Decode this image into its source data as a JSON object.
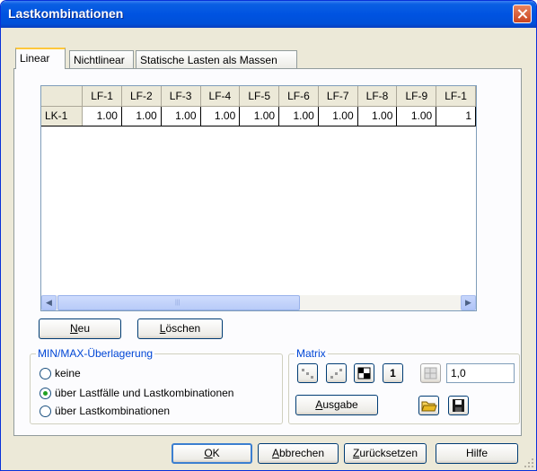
{
  "window": {
    "title": "Lastkombinationen"
  },
  "tabs": [
    {
      "label": "Linear",
      "active": true
    },
    {
      "label": "Nichtlinear",
      "active": false
    },
    {
      "label": "Statische Lasten als Massen",
      "active": false
    }
  ],
  "table": {
    "columns": [
      "LF-1",
      "LF-2",
      "LF-3",
      "LF-4",
      "LF-5",
      "LF-6",
      "LF-7",
      "LF-8",
      "LF-9",
      "LF-1"
    ],
    "rows": [
      {
        "label": "LK-1",
        "values": [
          "1.00",
          "1.00",
          "1.00",
          "1.00",
          "1.00",
          "1.00",
          "1.00",
          "1.00",
          "1.00",
          "1"
        ]
      }
    ]
  },
  "buttons": {
    "neu": {
      "access": "N",
      "rest": "eu"
    },
    "loeschen": {
      "access": "L",
      "rest": "öschen"
    },
    "ausgabe": {
      "access": "A",
      "rest": "usgabe"
    },
    "ok": {
      "access": "O",
      "rest": "K"
    },
    "abbrechen": {
      "access": "A",
      "rest": "bbrechen"
    },
    "zuruecksetzen": {
      "access": "Z",
      "rest": "urücksetzen"
    },
    "hilfe": {
      "label": "Hilfe"
    }
  },
  "minmax": {
    "label": "MIN/MAX-Überlagerung",
    "options": [
      {
        "label": "keine",
        "selected": false
      },
      {
        "label": "über Lastfälle und Lastkombinationen",
        "selected": true
      },
      {
        "label": "über Lastkombinationen",
        "selected": false
      }
    ]
  },
  "matrix": {
    "label": "Matrix",
    "one_button": "1",
    "factor_value": "1,0"
  },
  "colors": {
    "accent": "#0053e1",
    "group_label": "#0046d5",
    "radio_dot": "#21a121"
  }
}
